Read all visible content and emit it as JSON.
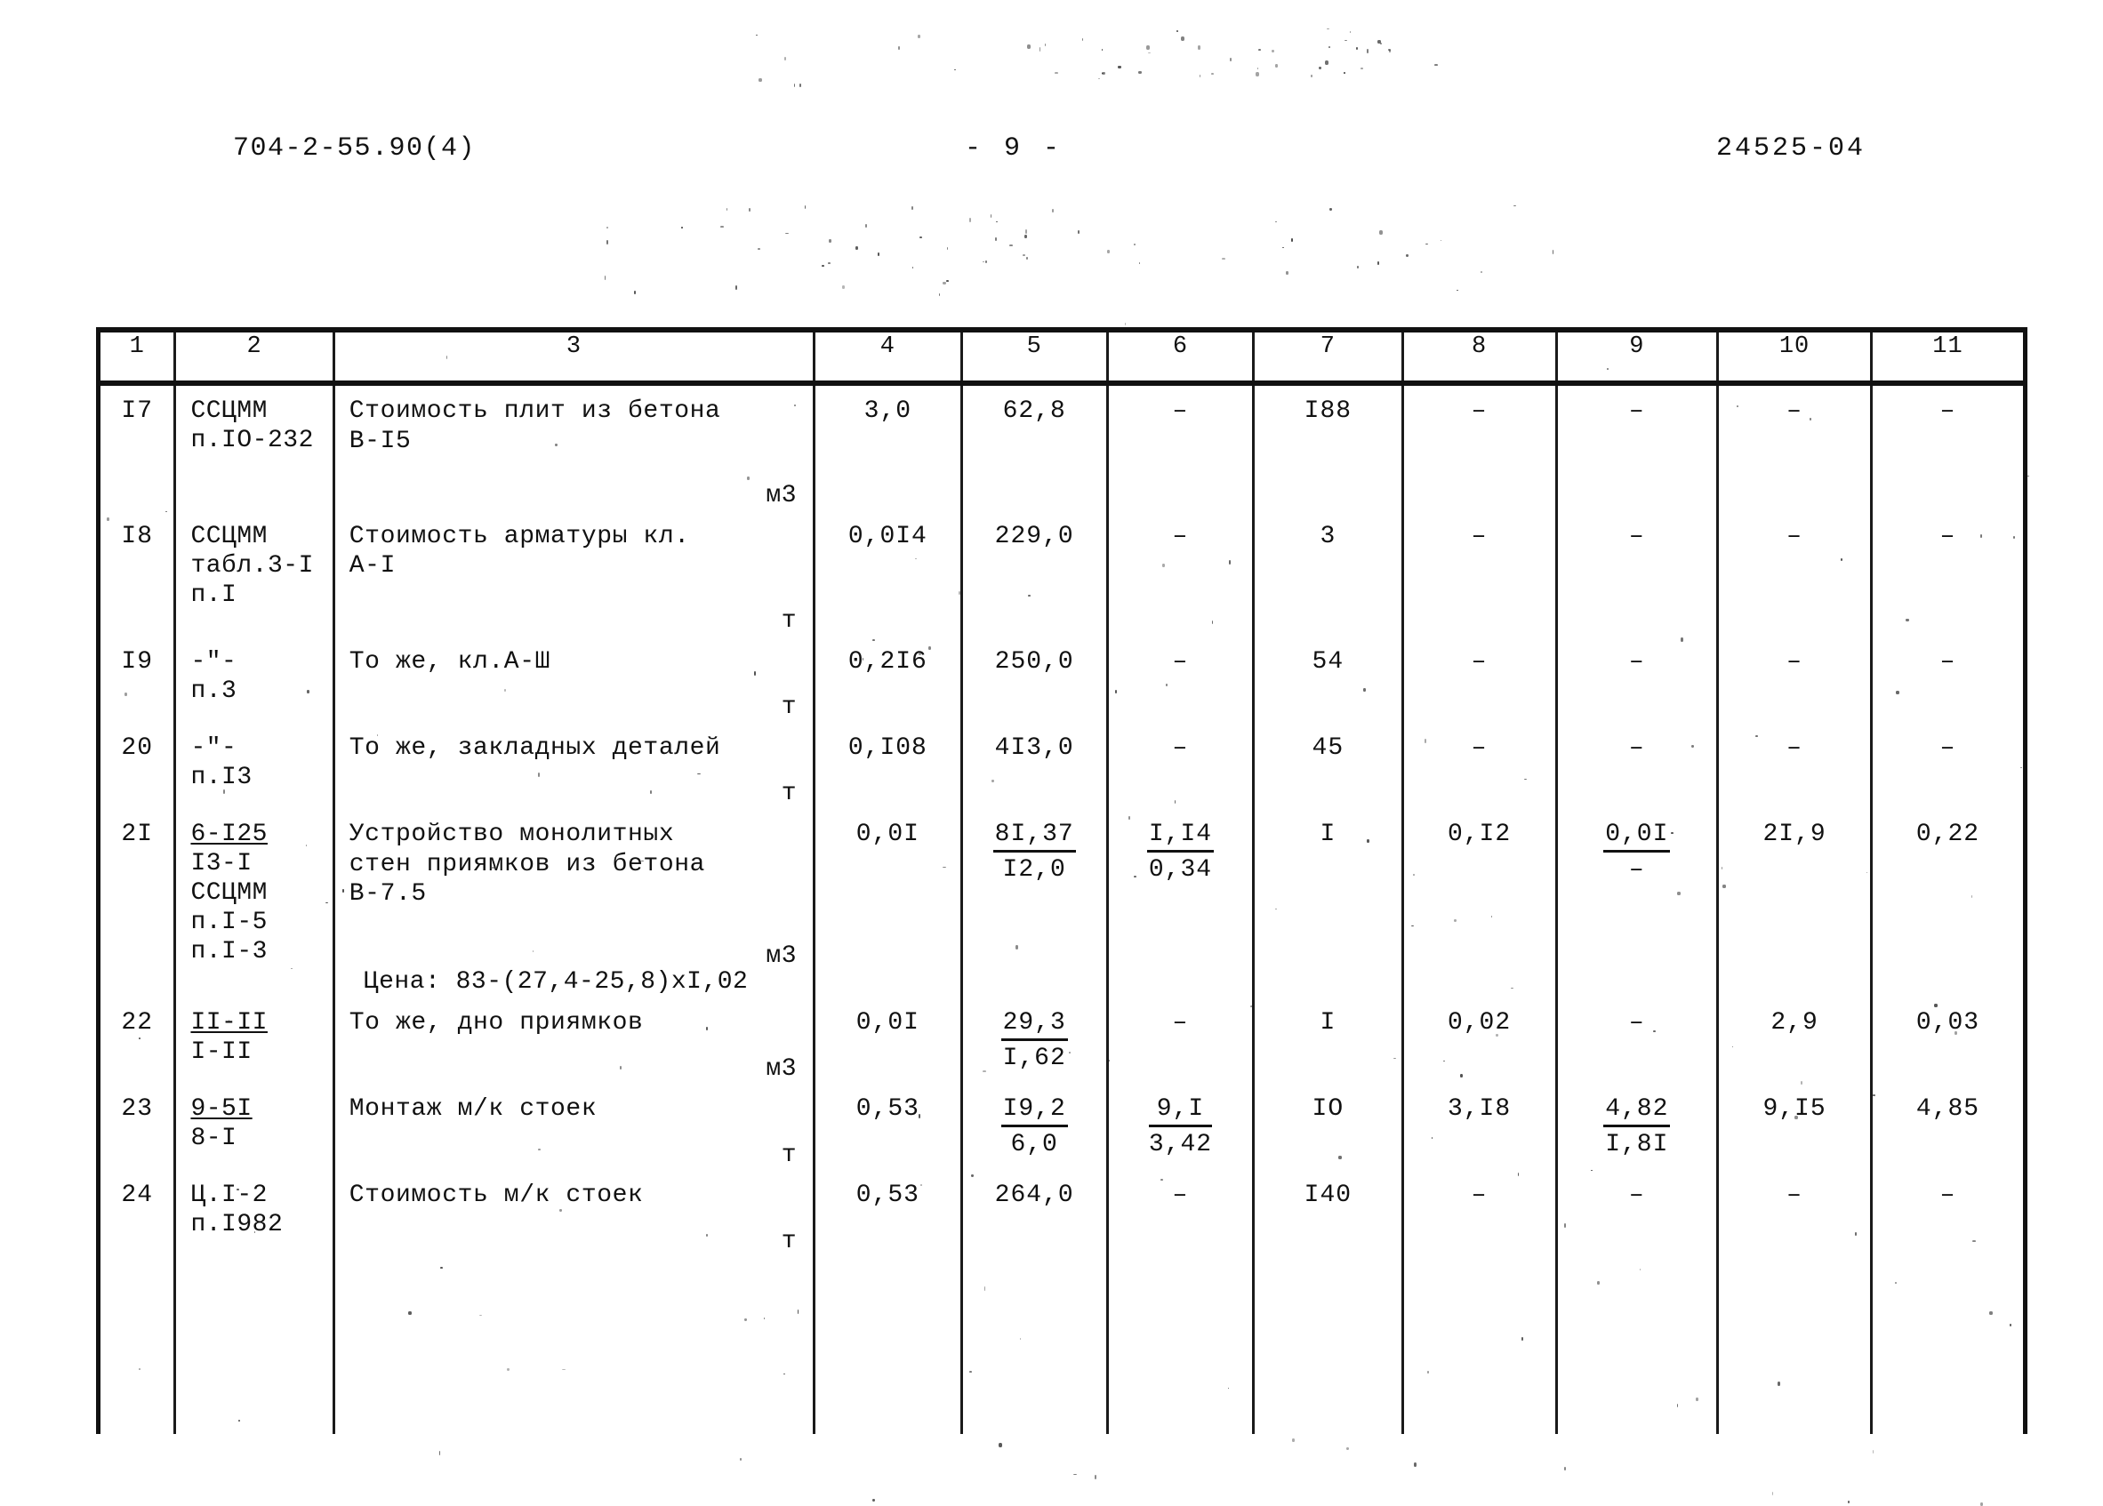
{
  "header": {
    "left_code": "704-2-55.90(4)",
    "page_marker": "- 9 -",
    "right_code": "24525-04"
  },
  "table": {
    "column_numbers": [
      "1",
      "2",
      "3",
      "4",
      "5",
      "6",
      "7",
      "8",
      "9",
      "10",
      "11"
    ],
    "rows": [
      {
        "num": "I7",
        "ref_lines": [
          "CCЦMM",
          "п.IO-232"
        ],
        "desc_lines": [
          "Стоимость плит из бетона",
          "В-I5"
        ],
        "unit": "м3",
        "c4": "3,0",
        "c5_top": "62,8",
        "c5_bot": "",
        "c6_top": "–",
        "c6_bot": "",
        "c7": "I88",
        "c8": "–",
        "c9_top": "–",
        "c9_bot": "",
        "c10": "–",
        "c11": "–"
      },
      {
        "num": "I8",
        "ref_lines": [
          "CCЦMM",
          "табл.3-I",
          "п.I"
        ],
        "desc_lines": [
          "Стоимость арматуры кл.",
          "А-I"
        ],
        "unit": "т",
        "c4": "0,0I4",
        "c5_top": "229,0",
        "c5_bot": "",
        "c6_top": "–",
        "c6_bot": "",
        "c7": "3",
        "c8": "–",
        "c9_top": "–",
        "c9_bot": "",
        "c10": "–",
        "c11": "–"
      },
      {
        "num": "I9",
        "ref_lines": [
          "-\"-",
          "п.3"
        ],
        "desc_lines": [
          "То же, кл.А-Ш"
        ],
        "unit": "т",
        "c4": "0,2I6",
        "c5_top": "250,0",
        "c5_bot": "",
        "c6_top": "–",
        "c6_bot": "",
        "c7": "54",
        "c8": "–",
        "c9_top": "–",
        "c9_bot": "",
        "c10": "–",
        "c11": "–"
      },
      {
        "num": "20",
        "ref_lines": [
          "-\"-",
          "п.I3"
        ],
        "desc_lines": [
          "То же, закладных деталей"
        ],
        "unit": "т",
        "c4": "0,I08",
        "c5_top": "4I3,0",
        "c5_bot": "",
        "c6_top": "–",
        "c6_bot": "",
        "c7": "45",
        "c8": "–",
        "c9_top": "–",
        "c9_bot": "",
        "c10": "–",
        "c11": "–"
      },
      {
        "num": "2I",
        "ref_lines": [
          "6-I25",
          "I3-I",
          "CCЦMM",
          "п.I-5",
          "п.I-3"
        ],
        "ref_underline_first": true,
        "desc_lines": [
          "Устройство монолитных",
          "стен приямков из бетона",
          "В-7.5"
        ],
        "unit": "м3",
        "price_line": "Цена: 83-(27,4-25,8)xI,02",
        "c4": "0,0I",
        "c5_top": "8I,37",
        "c5_bot": "I2,0",
        "c6_top": "I,I4",
        "c6_bot": "0,34",
        "c7": "I",
        "c8": "0,I2",
        "c9_top": "0,0I",
        "c9_bot": "–",
        "c10": "2I,9",
        "c11": "0,22"
      },
      {
        "num": "22",
        "ref_lines": [
          "II-II",
          "I-II"
        ],
        "ref_underline_first": true,
        "desc_lines": [
          "То же, дно приямков"
        ],
        "unit": "м3",
        "c4": "0,0I",
        "c5_top": "29,3",
        "c5_bot": "I,62",
        "c6_top": "–",
        "c6_bot": "",
        "c7": "I",
        "c8": "0,02",
        "c9_top": "–",
        "c9_bot": "",
        "c10": "2,9",
        "c11": "0,03"
      },
      {
        "num": "23",
        "ref_lines": [
          "9-5I",
          "8-I"
        ],
        "ref_underline_first": true,
        "desc_lines": [
          "Монтаж м/к стоек"
        ],
        "unit": "т",
        "c4": "0,53",
        "c5_top": "I9,2",
        "c5_bot": "6,0",
        "c6_top": "9,I",
        "c6_bot": "3,42",
        "c7": "IO",
        "c8": "3,I8",
        "c9_top": "4,82",
        "c9_bot": "I,8I",
        "c10": "9,I5",
        "c11": "4,85"
      },
      {
        "num": "24",
        "ref_lines": [
          "Ц.I-2",
          "п.I982"
        ],
        "desc_lines": [
          "Стоимость м/к стоек"
        ],
        "unit": "т",
        "c4": "0,53",
        "c5_top": "264,0",
        "c5_bot": "",
        "c6_top": "–",
        "c6_bot": "",
        "c7": "I40",
        "c8": "–",
        "c9_top": "–",
        "c9_bot": "",
        "c10": "–",
        "c11": "–"
      }
    ]
  }
}
